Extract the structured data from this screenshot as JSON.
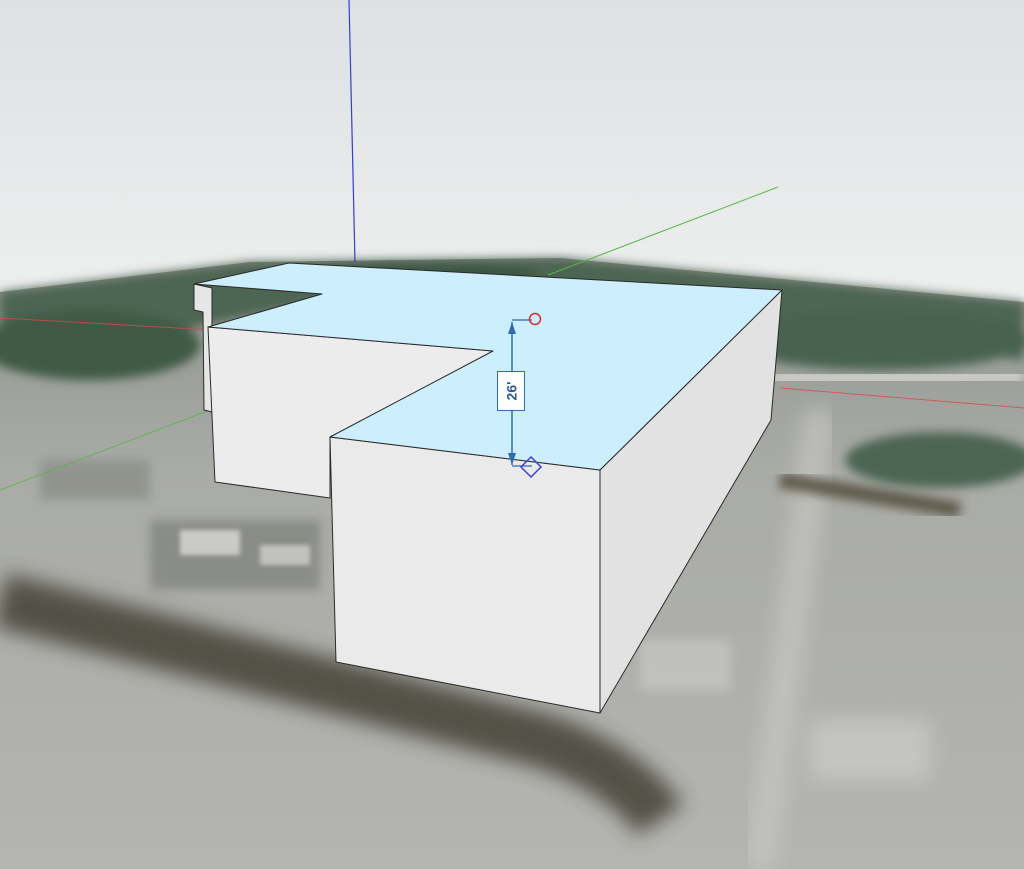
{
  "viewport": {
    "dimension_label": "26'"
  },
  "colors": {
    "sky_top": "#dde1e4",
    "sky_bottom": "#eef0ef",
    "ground": "#a7a9a5",
    "vegetation": "#4c6350",
    "roof_face": "#cdeefd",
    "wall_face": "#ececec",
    "wall_shade": "#e3e3e3",
    "edge": "#2a2a2a",
    "axis_red": "#d94a4a",
    "axis_green": "#55b544",
    "axis_blue": "#3a3ad0",
    "dimension_blue": "#2f6db3",
    "endpoint_red": "#d42a2a",
    "endpoint_blue": "#3f3fd6"
  },
  "icons": {
    "start_point": "red-circle-inference-icon",
    "end_point": "blue-diamond-inference-icon"
  }
}
